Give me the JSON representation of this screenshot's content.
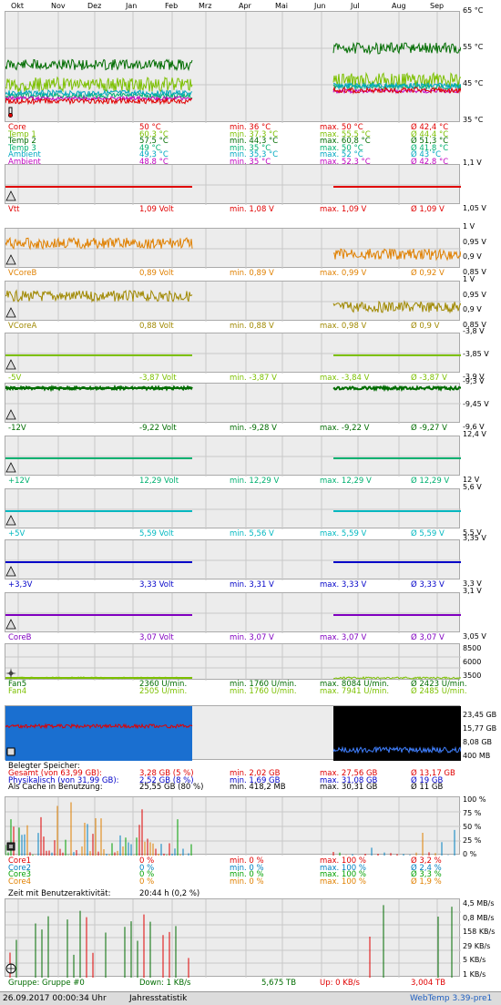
{
  "months": [
    "Okt",
    "Nov",
    "Dez",
    "Jan",
    "Feb",
    "Mrz",
    "Apr",
    "Mai",
    "Jun",
    "Jul",
    "Aug",
    "Sep"
  ],
  "colors": {
    "plot_bg": "#ececec",
    "grid": "#bdbdbd"
  },
  "temps": {
    "axis": [
      "65 °C",
      "55 °C",
      "45 °C",
      "35 °C"
    ],
    "rows": [
      {
        "name": "Core",
        "cur": "50 °C",
        "min": "min. 36 °C",
        "max": "max. 50 °C",
        "avg": "Ø 42,4 °C",
        "color": "#e00000"
      },
      {
        "name": "Temp 1",
        "cur": "60,3 °C",
        "min": "min. 37,3 °C",
        "max": "max. 55,5 °C",
        "avg": "Ø 44,4 °C",
        "color": "#7cc000"
      },
      {
        "name": "Temp 2",
        "cur": "57,5 °C",
        "min": "min. 44,3 °C",
        "max": "max. 60,8 °C",
        "avg": "Ø 51,3 °C",
        "color": "#006c00"
      },
      {
        "name": "Temp 3",
        "cur": "49 °C",
        "min": "min. 35 °C",
        "max": "max. 50 °C",
        "avg": "Ø 41,8 °C",
        "color": "#00b070"
      },
      {
        "name": "Ambient",
        "cur": "49,3 °C",
        "min": "min. 35,3 °C",
        "max": "max. 52 °C",
        "avg": "Ø 43 °C",
        "color": "#00a8c0"
      },
      {
        "name": "Ambient",
        "cur": "48,8 °C",
        "min": "min. 35 °C",
        "max": "max. 52,3 °C",
        "avg": "Ø 42,8 °C",
        "color": "#c000c0"
      }
    ]
  },
  "volts": [
    {
      "key": "vtt",
      "name": "Vtt",
      "cur": "1,09 Volt",
      "min": "min. 1,08 V",
      "max": "max. 1,09 V",
      "avg": "Ø 1,09 V",
      "color": "#e00000",
      "axis": [
        "1,1 V",
        "1,05 V"
      ]
    },
    {
      "key": "vcoreb",
      "name": "VCoreB",
      "cur": "0,89 Volt",
      "min": "min. 0,89 V",
      "max": "max. 0,99 V",
      "avg": "Ø 0,92 V",
      "color": "#e08000",
      "axis": [
        "1 V",
        "0,95 V",
        "0,9 V",
        "0,85 V"
      ]
    },
    {
      "key": "vcorea",
      "name": "VCoreA",
      "cur": "0,88 Volt",
      "min": "min. 0,88 V",
      "max": "max. 0,98 V",
      "avg": "Ø 0,9 V",
      "color": "#a08800",
      "axis": [
        "1 V",
        "0,95 V",
        "0,9 V",
        "0,85 V"
      ]
    },
    {
      "key": "m5v",
      "name": "-5V",
      "cur": "-3,87 Volt",
      "min": "min. -3,87 V",
      "max": "max. -3,84 V",
      "avg": "Ø -3,87 V",
      "color": "#7cc000",
      "axis": [
        "-3,8 V",
        "-3,85 V",
        "-3,9 V"
      ]
    },
    {
      "key": "m12v",
      "name": "-12V",
      "cur": "-9,22 Volt",
      "min": "min. -9,28 V",
      "max": "max. -9,22 V",
      "avg": "Ø -9,27 V",
      "color": "#006c00",
      "axis": [
        "-9,3 V",
        "-9,45 V",
        "-9,6 V"
      ]
    },
    {
      "key": "p12v",
      "name": "+12V",
      "cur": "12,29 Volt",
      "min": "min. 12,29 V",
      "max": "max. 12,29 V",
      "avg": "Ø 12,29 V",
      "color": "#00b070",
      "axis": [
        "12,4 V",
        "12 V"
      ]
    },
    {
      "key": "p5v",
      "name": "+5V",
      "cur": "5,59 Volt",
      "min": "min. 5,56 V",
      "max": "max. 5,59 V",
      "avg": "Ø 5,59 V",
      "color": "#00b8c0",
      "axis": [
        "5,6 V",
        "5,5 V"
      ]
    },
    {
      "key": "p33v",
      "name": "+3,3V",
      "cur": "3,33 Volt",
      "min": "min. 3,31 V",
      "max": "max. 3,33 V",
      "avg": "Ø 3,33 V",
      "color": "#0000c8",
      "axis": [
        "3,35 V",
        "3,3 V"
      ]
    },
    {
      "key": "coreb",
      "name": "CoreB",
      "cur": "3,07 Volt",
      "min": "min. 3,07 V",
      "max": "max. 3,07 V",
      "avg": "Ø 3,07 V",
      "color": "#8000c0",
      "axis": [
        "3,1 V",
        "3,05 V"
      ]
    }
  ],
  "fans": {
    "axis": [
      "8500",
      "6000",
      "3500"
    ],
    "rows": [
      {
        "name": "Fan5",
        "cur": "2360 U/min.",
        "min": "min. 1760 U/min.",
        "max": "max. 8084 U/min.",
        "avg": "Ø 2423 U/min.",
        "color": "#006c00"
      },
      {
        "name": "Fan4",
        "cur": "2505 U/min.",
        "min": "min. 1760 U/min.",
        "max": "max. 7941 U/min.",
        "avg": "Ø 2485 U/min.",
        "color": "#7cc000"
      }
    ]
  },
  "memory": {
    "axis": [
      "23,45 GB",
      "15,77 GB",
      "8,08 GB",
      "400 MB"
    ],
    "header": "Belegter Speicher:",
    "rows": [
      {
        "name": "Gesamt (von 63,99 GB):",
        "cur": "3,28 GB (5 %)",
        "min": "min. 2,02 GB",
        "max": "max. 27,56 GB",
        "avg": "Ø 13,17 GB",
        "color": "#e00000"
      },
      {
        "name": "Physikalisch (von 31,99 GB):",
        "cur": "2,52 GB (8 %)",
        "min": "min. 1,69 GB",
        "max": "max. 31,08 GB",
        "avg": "Ø 19 GB",
        "color": "#0000c8"
      },
      {
        "name": "Als Cache in Benutzung:",
        "cur": "25,55 GB (80 %)",
        "min": "min. 418,2 MB",
        "max": "max. 30,31 GB",
        "avg": "Ø 11 GB",
        "color": "#000000"
      }
    ]
  },
  "cpu": {
    "axis": [
      "100 %",
      "75 %",
      "50 %",
      "25 %",
      "0 %"
    ],
    "rows": [
      {
        "name": "Core1",
        "cur": "0 %",
        "min": "min. 0 %",
        "max": "max. 100 %",
        "avg": "Ø 3,2 %",
        "color": "#e00000"
      },
      {
        "name": "Core2",
        "cur": "0 %",
        "min": "min. 0 %",
        "max": "max. 100 %",
        "avg": "Ø 2,4 %",
        "color": "#0080c0"
      },
      {
        "name": "Core3",
        "cur": "0 %",
        "min": "min. 0 %",
        "max": "max. 100 %",
        "avg": "Ø 3,3 %",
        "color": "#00a000"
      },
      {
        "name": "Core4",
        "cur": "0 %",
        "min": "min. 0 %",
        "max": "max. 100 %",
        "avg": "Ø 1,9 %",
        "color": "#e08000"
      }
    ],
    "activity_label": "Zeit mit Benutzeraktivität:",
    "activity_value": "20:44 h (0,2 %)"
  },
  "network": {
    "axis": [
      "4,5 MB/s",
      "0,8 MB/s",
      "158 KB/s",
      "29 KB/s",
      "5 KB/s",
      "1 KB/s"
    ],
    "group": "Gruppe: Gruppe #0",
    "down": "Down: 1 KB/s",
    "down_total": "5,675 TB",
    "up": "Up: 0 KB/s",
    "up_total": "3,004 TB"
  },
  "footer": {
    "timestamp": "26.09.2017 00:00:34 Uhr",
    "title": "Jahresstatistik",
    "app": "WebTemp 3.39-pre1"
  }
}
